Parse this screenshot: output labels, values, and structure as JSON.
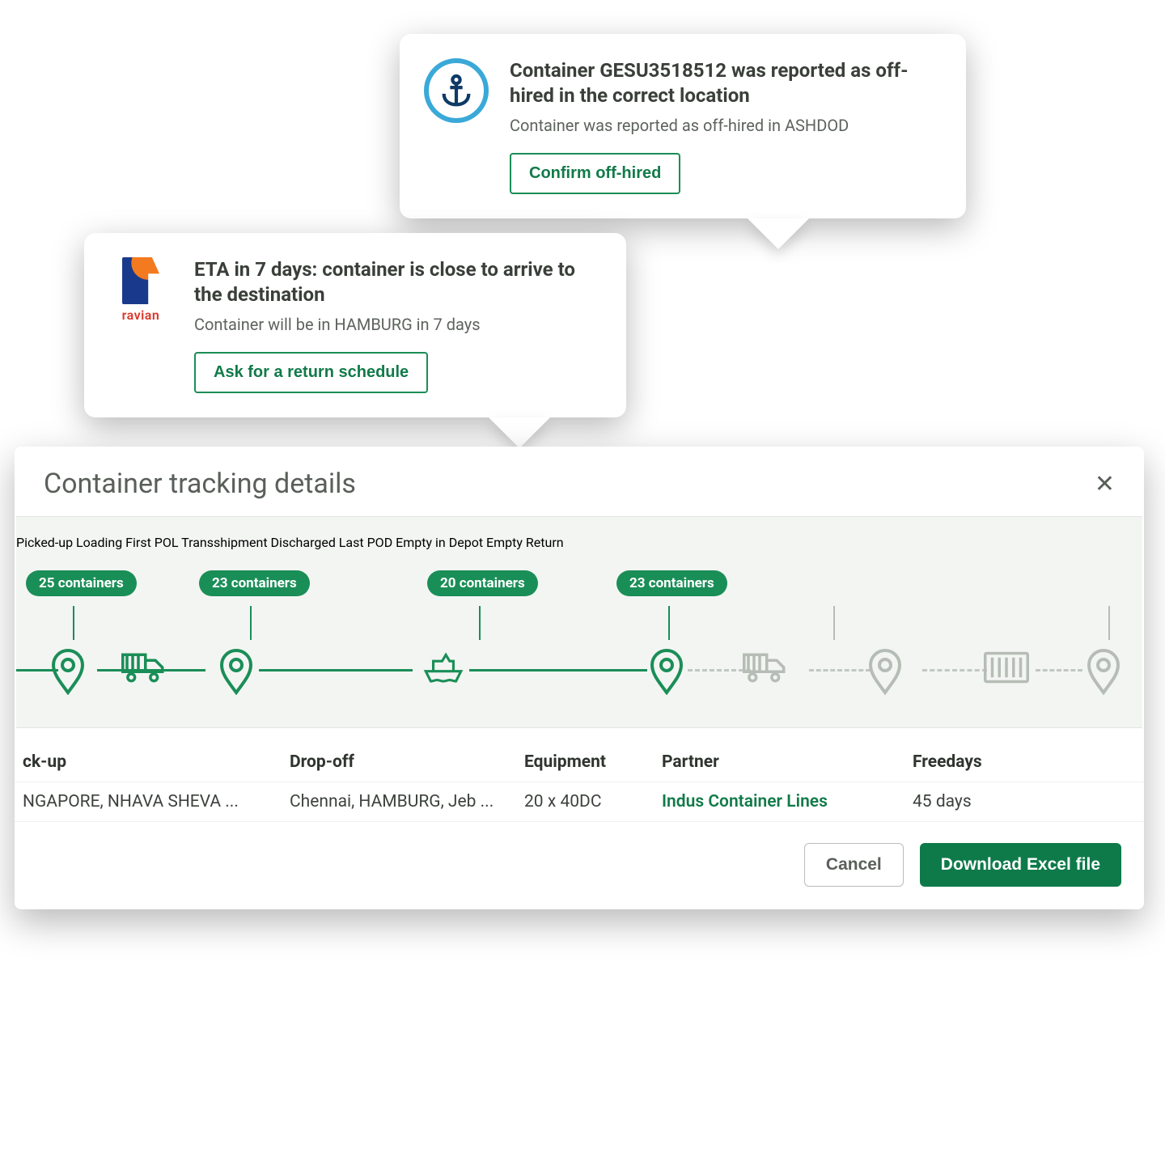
{
  "notifications": {
    "top": {
      "title": "Container GESU3518512 was reported as off-hired in the correct location",
      "subtitle": "Container was reported as off-hired in ASHDOD",
      "button": "Confirm off-hired"
    },
    "left": {
      "logo_name": "ravian",
      "title": "ETA in 7 days: container is close to arrive to the destination",
      "subtitle": "Container will be in HAMBURG in 7 days",
      "button": "Ask for a return schedule"
    }
  },
  "panel": {
    "title": "Container tracking details"
  },
  "timeline": {
    "stages": {
      "s1": "Picked-up",
      "s2": "Loading First POL",
      "s3": "Transshipment",
      "s4": "Discharged Last POD",
      "s5": "Empty in Depot",
      "s6": "Empty Return"
    },
    "badges": {
      "b1": "25 containers",
      "b2": "23 containers",
      "b3": "20 containers",
      "b4": "23 containers"
    }
  },
  "table": {
    "headers": {
      "pickup": "ck-up",
      "dropoff": "Drop-off",
      "equipment": "Equipment",
      "partner": "Partner",
      "freedays": "Freedays"
    },
    "row": {
      "pickup": "NGAPORE, NHAVA SHEVA ...",
      "dropoff": "Chennai, HAMBURG, Jeb ...",
      "equipment": "20 x 40DC",
      "partner": "Indus Container Lines",
      "freedays": "45 days"
    }
  },
  "footer": {
    "cancel": "Cancel",
    "download": "Download Excel file"
  }
}
